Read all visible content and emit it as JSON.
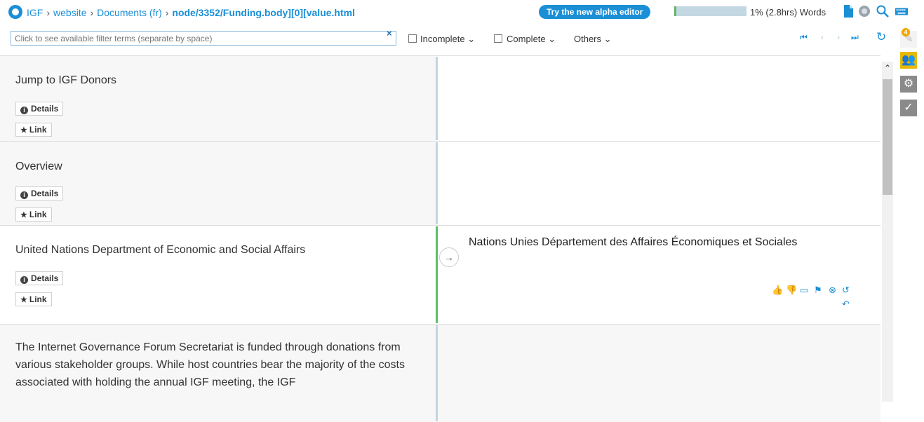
{
  "header": {
    "breadcrumbs": [
      "IGF",
      "website",
      "Documents (fr)"
    ],
    "current_path": "node/3352/Funding.body][0][value.html",
    "alpha_button": "Try the new alpha editor",
    "progress_percent": 1,
    "progress_text": "1% (2.8hrs) Words",
    "icons": [
      "document-icon",
      "globe-icon",
      "search-icon",
      "keyboard-icon"
    ]
  },
  "filterbar": {
    "placeholder": "Click to see available filter terms (separate by space)",
    "clear": "×",
    "incomplete": "Incomplete",
    "complete": "Complete",
    "others": "Others"
  },
  "rail": {
    "badge": "4",
    "icons": [
      "comments-icon",
      "users-icon",
      "settings-icon",
      "check-icon"
    ]
  },
  "segments": [
    {
      "source": "Jump to IGF Donors",
      "details": "Details",
      "link": "Link",
      "target": "",
      "status": "untranslated"
    },
    {
      "source": "Overview",
      "details": "Details",
      "link": "Link",
      "target": "",
      "status": "untranslated"
    },
    {
      "source": "United Nations Department of Economic and Social Affairs",
      "details": "Details",
      "link": "Link",
      "target": "Nations Unies Département des Affaires Économiques et Sociales",
      "status": "translated"
    },
    {
      "source": "The Internet Governance Forum Secretariat is funded through donations from various stakeholder groups. While host countries bear the majority of the costs associated with holding the annual IGF meeting, the IGF",
      "target": "",
      "status": "untranslated"
    }
  ],
  "colors": {
    "accent": "#1a8fd6",
    "translated": "#5bbf6a",
    "untranslated": "#c3d5de"
  }
}
